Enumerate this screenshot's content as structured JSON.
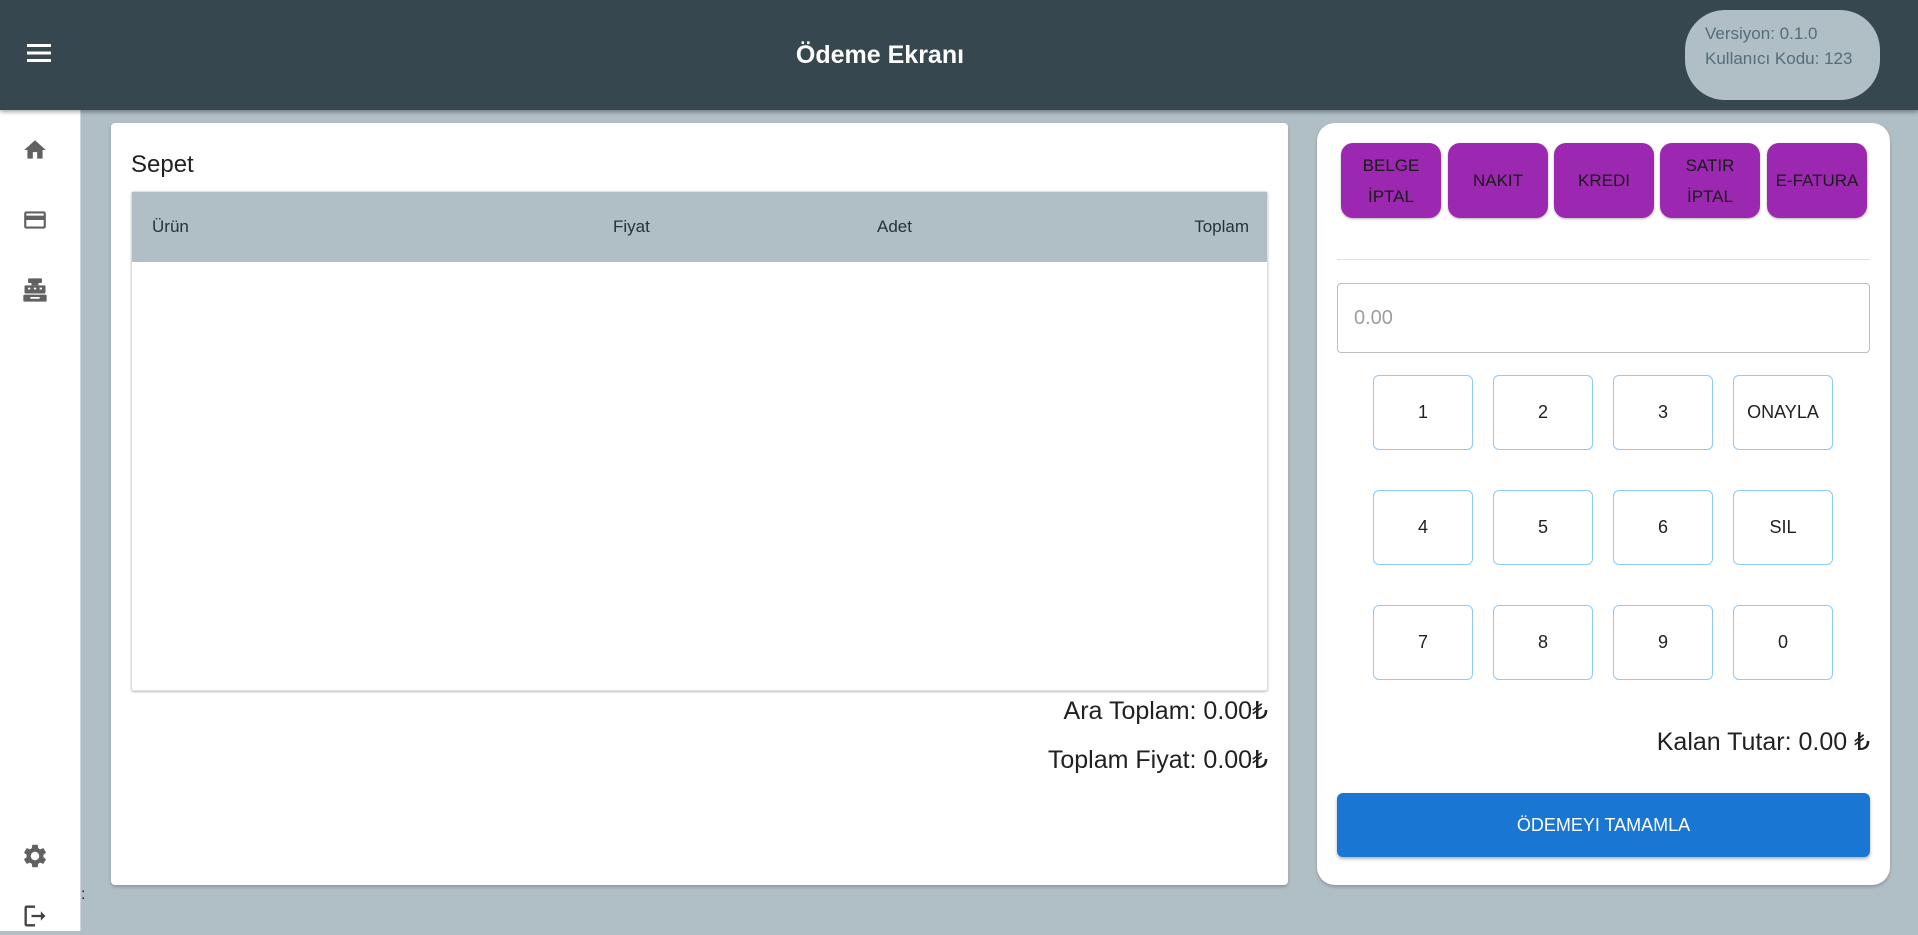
{
  "header": {
    "title": "Ödeme Ekranı",
    "version": "Versiyon: 0.1.0",
    "user_code": "Kullanıcı Kodu: 123"
  },
  "sidebar": {
    "items": [
      {
        "icon": "home-icon"
      },
      {
        "icon": "credit-card-icon"
      },
      {
        "icon": "cash-register-icon"
      },
      {
        "icon": "gear-icon"
      },
      {
        "icon": "logout-icon"
      }
    ],
    "stray_text": ":"
  },
  "basket": {
    "title": "Sepet",
    "columns": [
      "Ürün",
      "Fiyat",
      "Adet",
      "Toplam"
    ],
    "rows": [],
    "subtotal": "Ara Toplam: 0.00₺",
    "total": "Toplam Fiyat: 0.00₺"
  },
  "payment": {
    "actions": [
      "BELGE İPTAL",
      "NAKIT",
      "KREDI",
      "SATIR İPTAL",
      "E-FATURA"
    ],
    "amount_placeholder": "0.00",
    "amount_value": "",
    "keypad": [
      "1",
      "2",
      "3",
      "ONAYLA",
      "4",
      "5",
      "6",
      "SIL",
      "7",
      "8",
      "9",
      "0"
    ],
    "remaining": "Kalan Tutar: 0.00 ₺",
    "complete_label": "ÖDEMEYI TAMAMLA"
  },
  "colors": {
    "appbar": "#37474f",
    "background": "#b0bec5",
    "action_purple": "#9c27b0",
    "primary_blue": "#1976d2",
    "keypad_border": "#90caf9"
  }
}
